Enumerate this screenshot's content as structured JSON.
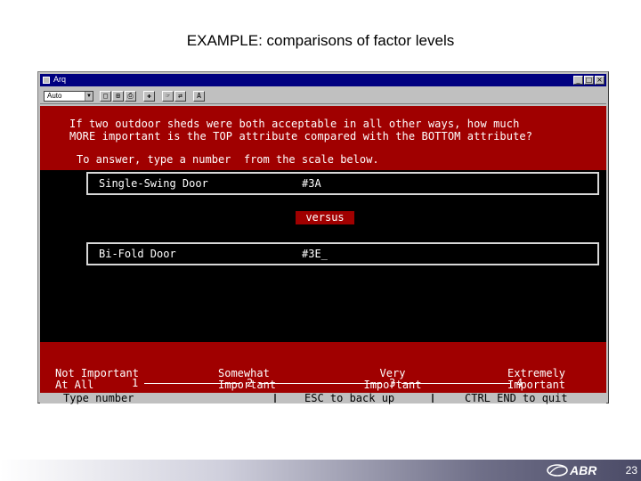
{
  "slide": {
    "title": "EXAMPLE:  comparisons of factor levels",
    "page_number": "23",
    "logo_text": "ABR"
  },
  "window": {
    "title": "Arq",
    "minimize_glyph": "_",
    "maximize_glyph": "□",
    "close_glyph": "×"
  },
  "toolbar": {
    "font_value": "Auto",
    "dropdown_glyph": "▼",
    "button_glyphs": [
      "□",
      "⊞",
      "⎙",
      "✚",
      "☞",
      "⇄",
      "A"
    ]
  },
  "question": {
    "line1": "If two outdoor sheds were both acceptable in all other ways, how much",
    "line2": "MORE important is the TOP attribute compared with the BOTTOM attribute?",
    "instruction": "To answer, type a number  from the scale below."
  },
  "top_attribute": {
    "name": "Single-Swing Door",
    "code": "#3A"
  },
  "versus_label": "versus",
  "bottom_attribute": {
    "name": "Bi-Fold Door",
    "code": "#3E_"
  },
  "scale": {
    "anchors": [
      {
        "line1": "Not Important",
        "line2": "At All"
      },
      {
        "line1": "Somewhat",
        "line2": "Important"
      },
      {
        "line1": "Very",
        "line2": "Important"
      },
      {
        "line1": "Extremely",
        "line2": "Important"
      }
    ],
    "numbers": [
      "1",
      "2",
      "3",
      "4"
    ]
  },
  "status": {
    "type_number": "Type number",
    "back": "ESC to back up",
    "quit": "CTRL END to quit"
  }
}
